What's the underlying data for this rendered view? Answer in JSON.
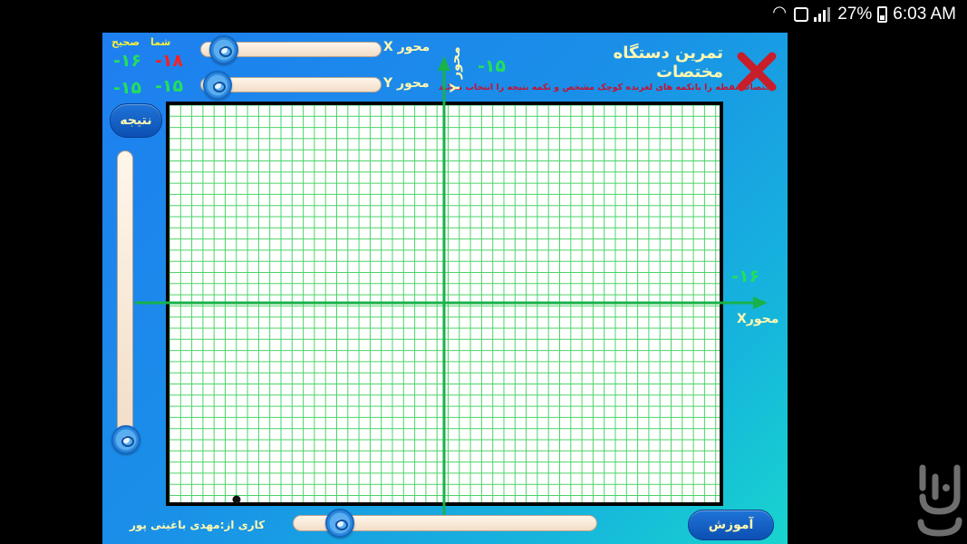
{
  "status_bar": {
    "battery": "27%",
    "time": "6:03 AM"
  },
  "app": {
    "title": "تمرین دستگاه مختصات",
    "instruction": "مختصات نقطه را باتکمه های لغزنده کوچک مشخص و تکمه نتیجه را انتخاب نمائید",
    "header_you": "شما",
    "header_correct": "صحیح",
    "x_you": "-۱۸",
    "x_correct": "-۱۶",
    "y_you": "-۱۵",
    "y_correct": "-۱۵",
    "x_slider_label": "محور X",
    "y_slider_label": "محور Y",
    "y_axis_label": "محور Y",
    "x_axis_label": "محورX",
    "y_axis_readout": "-۱۵",
    "x_axis_readout": "-۱۶",
    "result_button": "نتیجه",
    "tutorial_button": "آموزش",
    "credit": "کاری از:مهدی باغینی پور"
  },
  "colors": {
    "grid": "#4bd468",
    "axis": "#18b24a",
    "you_value": "#ff1f1f",
    "correct_value": "#22e05a",
    "label": "#fff8b0"
  },
  "icons": {
    "close": "close-x-icon",
    "wifi": "wifi-icon",
    "message": "message-icon",
    "signal": "signal-icon",
    "battery": "battery-icon",
    "store": "bazaar-logo"
  }
}
